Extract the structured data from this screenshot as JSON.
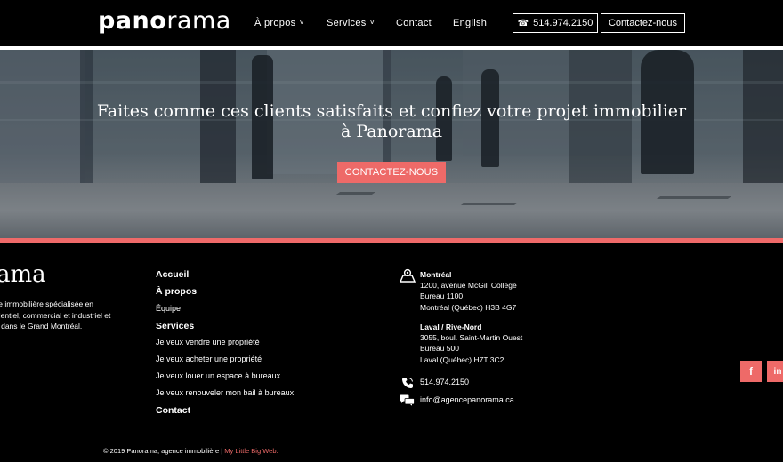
{
  "header": {
    "logo_bold": "pano",
    "logo_light": "rama",
    "nav": {
      "apropos": "À propos",
      "services": "Services",
      "contact": "Contact",
      "english": "English"
    },
    "phone_button": "514.974.2150",
    "contact_button": "Contactez-nous",
    "chevron_icon": "chevron-down-icon",
    "phone_icon": "phone-icon"
  },
  "hero": {
    "title_line1": "Faites comme ces clients satisfaits et confiez votre projet immobilier",
    "title_line2": "à Panorama",
    "cta": "CONTACTEZ-NOUS",
    "accent_color": "#ef6a69"
  },
  "footer": {
    "logo_text": "ama",
    "description": [
      "ce immobilière spécialisée en",
      "identiel, commercial et industriel et",
      "e dans le Grand Montréal."
    ],
    "nav": {
      "accueil": "Accueil",
      "apropos": "À propos",
      "equipe": "Équipe",
      "services": "Services",
      "vendre": "Je veux vendre une propriété",
      "acheter": "Je veux acheter une propriété",
      "louer": "Je veux louer un espace à bureaux",
      "renouveler": "Je veux renouveler mon bail à bureaux",
      "contact": "Contact"
    },
    "offices": [
      {
        "city": "Montréal",
        "line1": "1200, avenue McGill College",
        "line2": "Bureau 1100",
        "line3": "Montréal (Québec) H3B 4G7"
      },
      {
        "city": "Laval / Rive-Nord",
        "line1": "3055, boul. Saint-Martin Ouest",
        "line2": "Bureau 500",
        "line3": "Laval (Québec) H7T 3C2"
      }
    ],
    "phone": "514.974.2150",
    "email": "info@agencepanorama.ca",
    "social": {
      "facebook": "f",
      "linkedin": "in"
    },
    "copyright": "© 2019 Panorama, agence immobilière | ",
    "credit_link": "My Little Big Web."
  }
}
